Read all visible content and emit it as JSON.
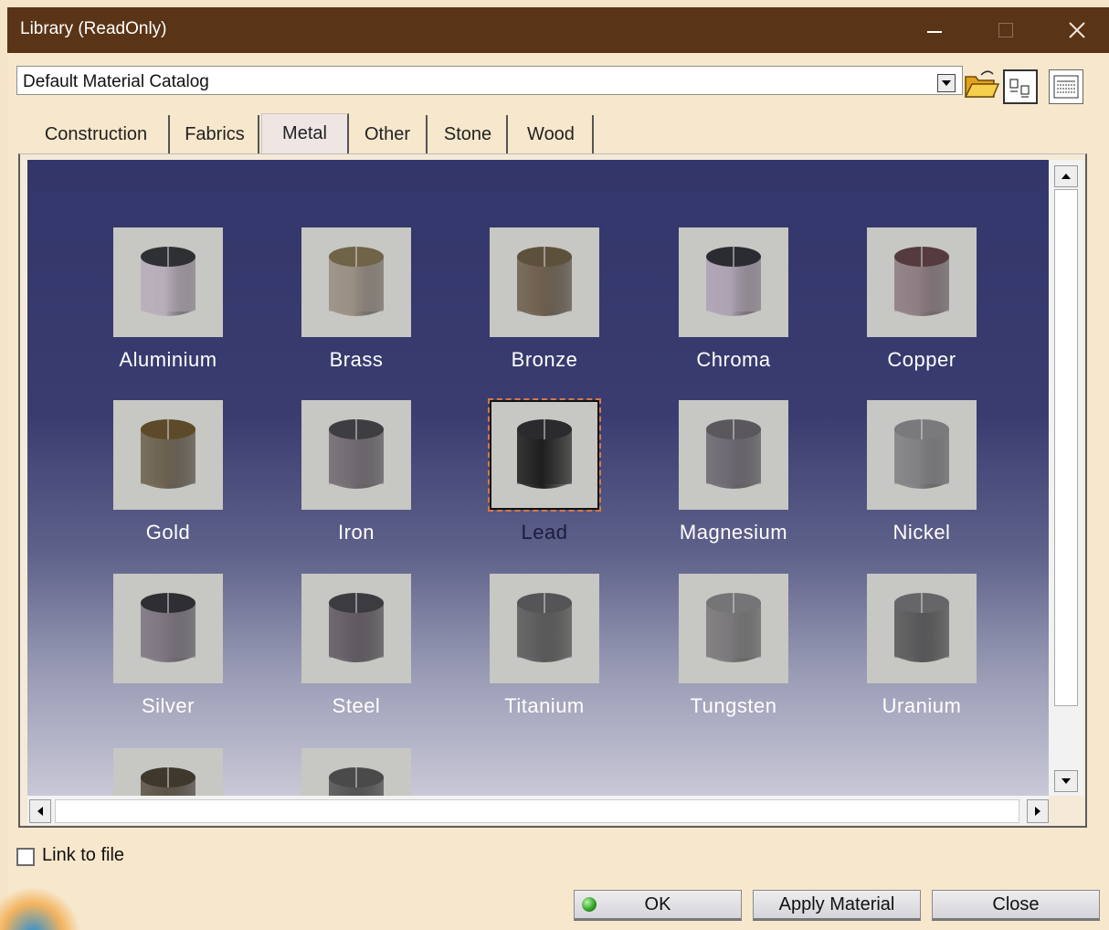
{
  "window": {
    "title": "Library (ReadOnly)"
  },
  "toolbar": {
    "catalog_value": "Default Material Catalog",
    "icons": [
      "dropdown-arrow-icon",
      "open-folder-icon",
      "icon-view-icon",
      "list-view-icon"
    ]
  },
  "tabs": [
    {
      "label": "Construction"
    },
    {
      "label": "Fabrics"
    },
    {
      "label": "Metal"
    },
    {
      "label": "Other"
    },
    {
      "label": "Stone"
    },
    {
      "label": "Wood"
    }
  ],
  "active_tab": "Metal",
  "materials": [
    {
      "name": "Aluminium",
      "body": "#b7aebb",
      "top": "#2f3034"
    },
    {
      "name": "Brass",
      "body": "#9a8f83",
      "top": "#6f6448"
    },
    {
      "name": "Bronze",
      "body": "#6e604e",
      "top": "#5d513c"
    },
    {
      "name": "Chroma",
      "body": "#ada2b3",
      "top": "#2b2c31"
    },
    {
      "name": "Copper",
      "body": "#8d7d83",
      "top": "#553b3e"
    },
    {
      "name": "Gold",
      "body": "#6d6150",
      "top": "#5c4a2a"
    },
    {
      "name": "Iron",
      "body": "#706a72",
      "top": "#3e3e42"
    },
    {
      "name": "Lead",
      "body": "#1e1e20",
      "top": "#2b2b2d"
    },
    {
      "name": "Magnesium",
      "body": "#6c6870",
      "top": "#5a585c"
    },
    {
      "name": "Nickel",
      "body": "#818084",
      "top": "#7a797c"
    },
    {
      "name": "Silver",
      "body": "#7d7580",
      "top": "#2f2f33"
    },
    {
      "name": "Steel",
      "body": "#615c64",
      "top": "#3c3b3f"
    },
    {
      "name": "Titanium",
      "body": "#5a5a5c",
      "top": "#555557"
    },
    {
      "name": "Tungsten",
      "body": "#7a787b",
      "top": "#757476"
    },
    {
      "name": "Uranium",
      "body": "#58585a",
      "top": "#666668"
    },
    {
      "name": "",
      "body": "#5d5446",
      "top": "#3f382c"
    },
    {
      "name": "",
      "body": "#555556",
      "top": "#4a4a4b"
    }
  ],
  "selected_material": "Lead",
  "footer": {
    "link_label": "Link to file",
    "link_checked": false,
    "ok_label": "OK",
    "apply_label": "Apply Material",
    "close_label": "Close"
  },
  "colors": {
    "titlebar": "#5a3417",
    "background": "#f7e7cc",
    "viewport_top": "#33366a",
    "viewport_bottom": "#c8c8d6",
    "selection_outline": "#d4784a",
    "ok_indicator": "#2e9b22"
  }
}
